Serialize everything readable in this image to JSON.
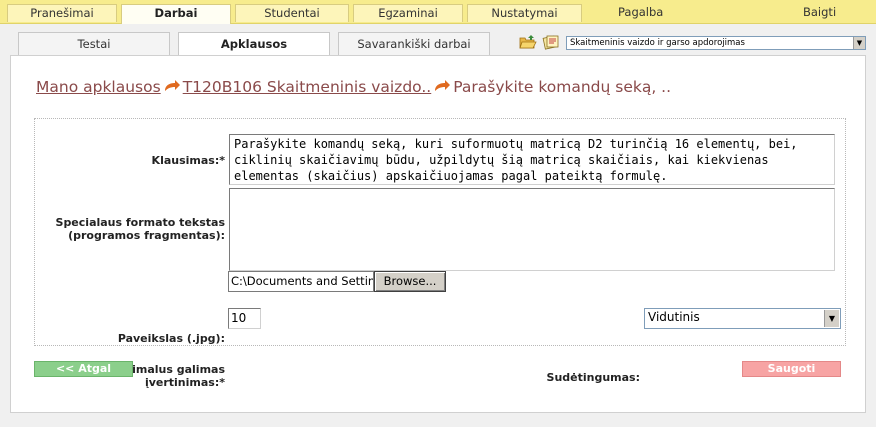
{
  "topnav": {
    "tabs": [
      {
        "label": "Pranešimai"
      },
      {
        "label": "Darbai"
      },
      {
        "label": "Studentai"
      },
      {
        "label": "Egzaminai"
      },
      {
        "label": "Nustatymai"
      }
    ],
    "help_label": "Pagalba",
    "logout_label": "Baigti"
  },
  "subnav": {
    "tabs": [
      {
        "label": "Testai"
      },
      {
        "label": "Apklausos"
      },
      {
        "label": "Savarankiški darbai"
      }
    ],
    "icons": [
      "open-folder-icon",
      "notes-icon"
    ],
    "course_select_value": "Skaitmeninis vaizdo ir garso apdorojimas"
  },
  "breadcrumb": {
    "link1": "Mano apklausos",
    "link2": "T120B106 Skaitmeninis vaizdo..",
    "current": "Parašykite komandų seką, .."
  },
  "form": {
    "question_label": "Klausimas:*",
    "question_value": "Parašykite komandų seką, kuri suformuotų matricą D2 turinčią 16 elementų, bei, ciklinių skaičiavimų būdu, užpildytų šią matricą skaičiais, kai kiekvienas elementas (skaičius) apskaičiuojamas pagal pateiktą formulę.",
    "special_label": "Specialaus formato tekstas (programos fragmentas):",
    "special_value": "",
    "image_label": "Paveikslas (.jpg):",
    "image_path": "C:\\Documents and Settings",
    "browse_label": "Browse...",
    "max_score_label": "Maksimalus galimas įvertinimas:*",
    "max_score_value": "10",
    "difficulty_label": "Sudėtingumas:",
    "difficulty_value": "Vidutinis"
  },
  "buttons": {
    "back_label": "<< Atgal",
    "save_label": "Saugoti"
  },
  "colors": {
    "topnav_bg": "#f7ec8d",
    "breadcrumb": "#8a4a4a",
    "back_button": "#8bcf8b",
    "save_button": "#f7a4a4"
  }
}
